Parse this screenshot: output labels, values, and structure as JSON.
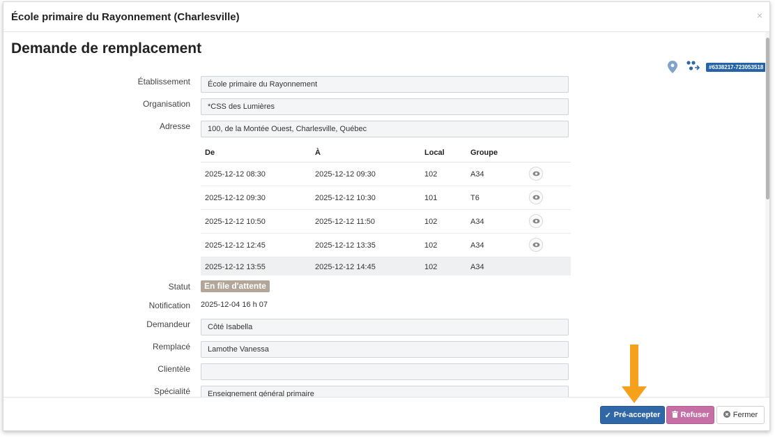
{
  "window": {
    "title": "École primaire du Rayonnement (Charlesville)",
    "close_symbol": "×"
  },
  "page": {
    "title": "Demande de remplacement"
  },
  "toolbar": {
    "id_badge": "#6338217-723053518"
  },
  "form": {
    "etablissement": {
      "label": "Établissement",
      "value": "École primaire du Rayonnement"
    },
    "organisation": {
      "label": "Organisation",
      "value": "*CSS des Lumières"
    },
    "adresse": {
      "label": "Adresse",
      "value": "100, de la Montée Ouest, Charlesville, Québec"
    },
    "statut": {
      "label": "Statut",
      "value": "En file d'attente"
    },
    "notification": {
      "label": "Notification",
      "value": "2025-12-04 16 h 07"
    },
    "demandeur": {
      "label": "Demandeur",
      "value": "Côté Isabella"
    },
    "remplace": {
      "label": "Remplacé",
      "value": "Lamothe Vanessa"
    },
    "clientele": {
      "label": "Clientèle",
      "value": ""
    },
    "specialite": {
      "label": "Spécialité",
      "value": "Enseignement général primaire"
    }
  },
  "schedule": {
    "headers": [
      "De",
      "À",
      "Local",
      "Groupe"
    ],
    "rows": [
      {
        "de": "2025-12-12 08:30",
        "a": "2025-12-12 09:30",
        "local": "102",
        "groupe": "A34"
      },
      {
        "de": "2025-12-12 09:30",
        "a": "2025-12-12 10:30",
        "local": "101",
        "groupe": "T6"
      },
      {
        "de": "2025-12-12 10:50",
        "a": "2025-12-12 11:50",
        "local": "102",
        "groupe": "A34"
      },
      {
        "de": "2025-12-12 12:45",
        "a": "2025-12-12 13:35",
        "local": "102",
        "groupe": "A34"
      },
      {
        "de": "2025-12-12 13:55",
        "a": "2025-12-12 14:45",
        "local": "102",
        "groupe": "A34"
      }
    ]
  },
  "footer": {
    "accept_label": "Pré-accepter",
    "refuse_label": "Refuser",
    "close_label": "Fermer"
  },
  "colors": {
    "accent": "#2f67a7",
    "refuse": "#c66fa6",
    "status_badge": "#b3a597",
    "arrow": "#f5a11c"
  },
  "icons": [
    "pin-icon",
    "share-icon",
    "eye-icon",
    "check-icon",
    "trash-icon",
    "close-circle-icon",
    "arrow-down-icon"
  ]
}
